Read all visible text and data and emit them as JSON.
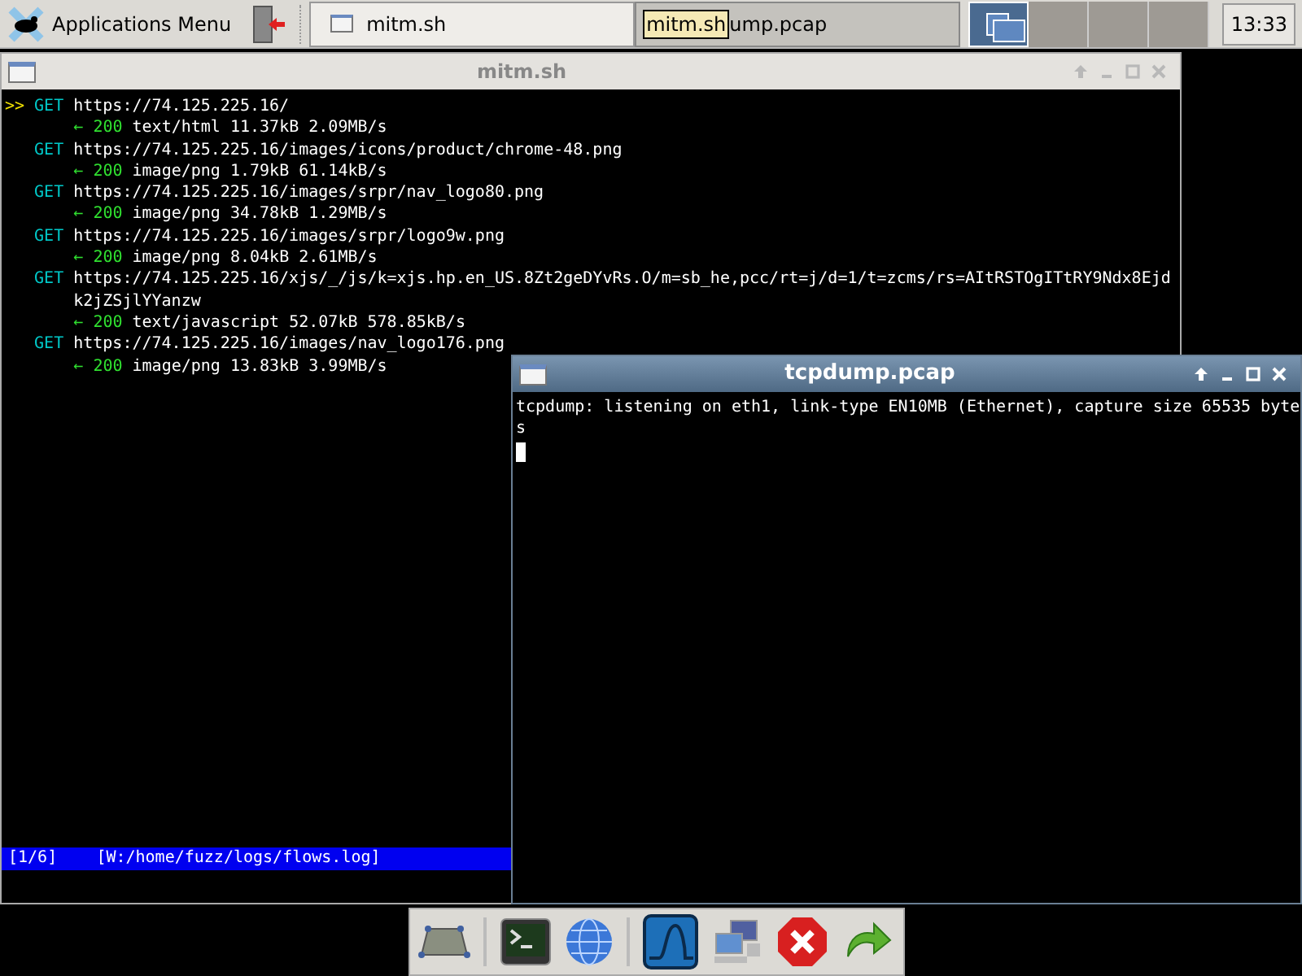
{
  "panel": {
    "app_menu": "Applications Menu",
    "tasks": [
      {
        "label": "mitm.sh",
        "selected": true
      },
      {
        "label": "ump.pcap",
        "selected": false,
        "tooltip": "mitm.sh"
      }
    ],
    "workspaces": [
      {
        "selected": true
      },
      {
        "selected": false
      },
      {
        "selected": false
      },
      {
        "selected": false
      }
    ],
    "clock": "13:33"
  },
  "mitm_window": {
    "title": "mitm.sh",
    "focus_marker": ">>",
    "flows": [
      {
        "selected": true,
        "method": "GET",
        "url": "https://74.125.225.16/",
        "arrow": "←",
        "status": "200",
        "detail": "text/html 11.37kB 2.09MB/s"
      },
      {
        "selected": false,
        "method": "GET",
        "url": "https://74.125.225.16/images/icons/product/chrome-48.png",
        "arrow": "←",
        "status": "200",
        "detail": "image/png 1.79kB 61.14kB/s"
      },
      {
        "selected": false,
        "method": "GET",
        "url": "https://74.125.225.16/images/srpr/nav_logo80.png",
        "arrow": "←",
        "status": "200",
        "detail": "image/png 34.78kB 1.29MB/s"
      },
      {
        "selected": false,
        "method": "GET",
        "url": "https://74.125.225.16/images/srpr/logo9w.png",
        "arrow": "←",
        "status": "200",
        "detail": "image/png 8.04kB 2.61MB/s"
      },
      {
        "selected": false,
        "method": "GET",
        "url": "https://74.125.225.16/xjs/_/js/k=xjs.hp.en_US.8Zt2geDYvRs.O/m=sb_he,pcc/rt=j/d=1/t=zcms/rs=AItRSTOgITtRY9Ndx8Ejdk2jZSjlYYanzw",
        "arrow": "←",
        "status": "200",
        "detail": "text/javascript 52.07kB 578.85kB/s"
      },
      {
        "selected": false,
        "method": "GET",
        "url": "https://74.125.225.16/images/nav_logo176.png",
        "arrow": "←",
        "status": "200",
        "detail": "image/png 13.83kB 3.99MB/s"
      }
    ],
    "status_bar": {
      "position": "[1/6]",
      "file": "[W:/home/fuzz/logs/flows.log]"
    }
  },
  "tcpdump_window": {
    "title": "tcpdump.pcap",
    "output": "tcpdump: listening on eth1, link-type EN10MB (Ethernet), capture size 65535 bytes"
  }
}
